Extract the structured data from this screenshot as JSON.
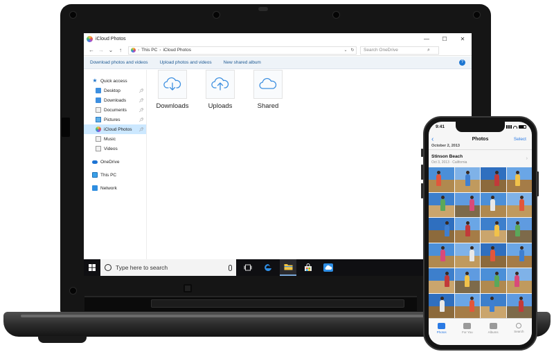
{
  "window": {
    "title": "iCloud Photos",
    "controls": {
      "minimize": "—",
      "maximize": "☐",
      "close": "✕"
    }
  },
  "addressbar": {
    "back": "←",
    "forward": "→",
    "history": "⌄",
    "up": "↑",
    "crumbs": [
      "This PC",
      "iCloud Photos"
    ],
    "separator": "›",
    "dropdown": "⌄",
    "refresh": "↻",
    "search_placeholder": "Search OneDrive",
    "search_icon": "⌕"
  },
  "commandbar": {
    "items": [
      "Download photos and videos",
      "Upload photos and videos",
      "New shared album"
    ],
    "help": "?"
  },
  "navpane": {
    "quick_access": "Quick access",
    "items": [
      {
        "label": "Desktop",
        "pinned": true,
        "icon": "desktop-icon"
      },
      {
        "label": "Downloads",
        "pinned": true,
        "icon": "downloads-icon"
      },
      {
        "label": "Documents",
        "pinned": true,
        "icon": "documents-icon"
      },
      {
        "label": "Pictures",
        "pinned": true,
        "icon": "pictures-icon"
      },
      {
        "label": "iCloud Photos",
        "pinned": true,
        "icon": "icloud-photos-icon",
        "selected": true
      },
      {
        "label": "Music",
        "pinned": false,
        "icon": "music-icon"
      },
      {
        "label": "Videos",
        "pinned": false,
        "icon": "videos-icon"
      }
    ],
    "onedrive": "OneDrive",
    "this_pc": "This PC",
    "network": "Network"
  },
  "folders": [
    {
      "label": "Downloads",
      "icon": "cloud-download-icon"
    },
    {
      "label": "Uploads",
      "icon": "cloud-upload-icon"
    },
    {
      "label": "Shared",
      "icon": "cloud-icon"
    }
  ],
  "taskbar": {
    "search_text": "Type here to search"
  },
  "phone": {
    "time": "9:41",
    "nav_title": "Photos",
    "select": "Select",
    "date_header": "October 2, 2013",
    "place": "Stinson Beach",
    "place_sub": "Oct 3, 2013 · California",
    "tabs": [
      {
        "label": "Photos",
        "active": true
      },
      {
        "label": "For You",
        "active": false
      },
      {
        "label": "Albums",
        "active": false
      },
      {
        "label": "Search",
        "active": false
      }
    ]
  },
  "colors": {
    "accent": "#1e5a93",
    "selection": "#cce8ff",
    "ios_blue": "#2a7ae4",
    "taskbar": "#0f0f12"
  }
}
